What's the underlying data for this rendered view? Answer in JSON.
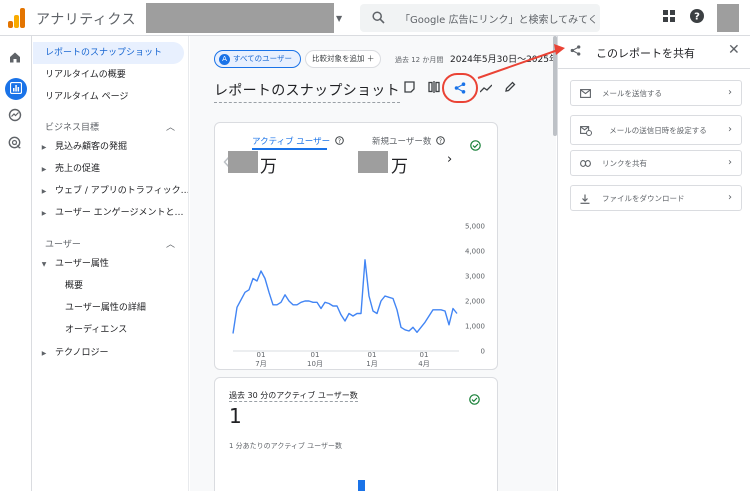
{
  "app": {
    "title": "アナリティクス",
    "search_placeholder": "「Google 広告にリンク」と検索してみてく…"
  },
  "nav": {
    "items": [
      {
        "label": "レポートのスナップショット",
        "active": true
      },
      {
        "label": "リアルタイムの概要"
      },
      {
        "label": "リアルタイム ページ"
      }
    ],
    "sections": [
      {
        "title": "ビジネス目標",
        "children": [
          "見込み顧客の発掘",
          "売上の促進",
          "ウェブ / アプリのトラフィック…",
          "ユーザー エンゲージメントと…"
        ]
      },
      {
        "title": "ユーザー",
        "group": "ユーザー属性",
        "leaves": [
          "概要",
          "ユーザー属性の詳細",
          "オーディエンス"
        ],
        "after": "テクノロジー"
      }
    ]
  },
  "toolbar": {
    "all_users_chip": "すべてのユーザー",
    "all_users_badge": "A",
    "compare_chip": "比較対象を追加 ＋",
    "date_label": "過去 12 か月間",
    "date_range": "2024年5月30日～2025年"
  },
  "page": {
    "title": "レポートのスナップショット"
  },
  "card1": {
    "metric1_label": "アクティブ ユーザー",
    "metric1_unit": "万",
    "metric2_label": "新規ユーザー数",
    "metric2_unit": "万"
  },
  "card2": {
    "label": "過去 30 分のアクティブ ユーザー数",
    "value": "1",
    "sub_label": "1 分あたりのアクティブ ユーザー数"
  },
  "share_panel": {
    "title": "このレポートを共有",
    "options": [
      {
        "label": "メールを送信する",
        "icon": "mail-icon"
      },
      {
        "label": "メールの送信日時を設定する",
        "icon": "schedule-mail-icon"
      },
      {
        "label": "リンクを共有",
        "icon": "link-icon"
      },
      {
        "label": "ファイルをダウンロード",
        "icon": "download-icon"
      }
    ]
  },
  "colors": {
    "accent": "#1a73e8",
    "annotation": "#ea4335",
    "line": "#4285f4"
  },
  "chart_data": {
    "type": "line",
    "title": "",
    "xlabel": "",
    "ylabel": "",
    "ylim": [
      0,
      5000
    ],
    "y_ticks": [
      "5,000",
      "4,000",
      "3,000",
      "2,000",
      "1,000",
      "0"
    ],
    "x_ticks": [
      {
        "day": "01",
        "month": "7月"
      },
      {
        "day": "01",
        "month": "10月"
      },
      {
        "day": "01",
        "month": "1月"
      },
      {
        "day": "01",
        "month": "4月"
      }
    ],
    "series": [
      {
        "values": [
          700,
          1750,
          2050,
          2350,
          2450,
          2900,
          2800,
          3200,
          2900,
          2350,
          1850,
          1850,
          1950,
          2250,
          2000,
          1850,
          1850,
          1950,
          2000,
          2000,
          1950,
          1950,
          1700,
          1950,
          1900,
          1800,
          1800,
          1450,
          1200,
          1500,
          1400,
          1500,
          1500,
          3650,
          2200,
          1600,
          1500,
          2000,
          2200,
          2150,
          2100,
          1650,
          950,
          850,
          800,
          950,
          750,
          950,
          1150,
          1400,
          1650,
          1650,
          1650,
          1600,
          1050,
          1700,
          1500
        ]
      }
    ]
  }
}
